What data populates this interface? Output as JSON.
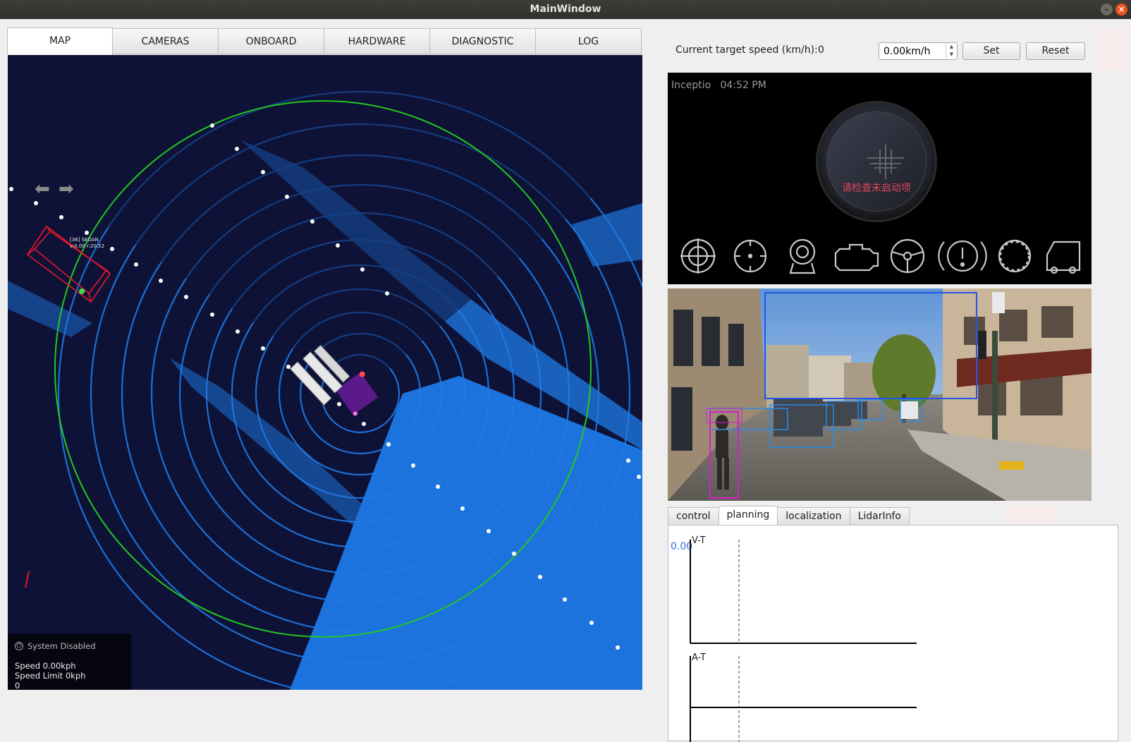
{
  "window": {
    "title": "MainWindow"
  },
  "tabs": [
    {
      "label": "MAP",
      "active": true
    },
    {
      "label": "CAMERAS",
      "active": false
    },
    {
      "label": "ONBOARD",
      "active": false
    },
    {
      "label": "HARDWARE",
      "active": false
    },
    {
      "label": "DIAGNOSTIC",
      "active": false
    },
    {
      "label": "LOG",
      "active": false
    }
  ],
  "map": {
    "status_title": "System Disabled",
    "speed": "Speed 0.00kph",
    "speed_limit": "Speed Limit 0kph",
    "extra": "0",
    "obstacle_label_1": "[36] SEDAN",
    "obstacle_label_2": "v:0.00 r:20.52",
    "colors": {
      "background": "#0e1237",
      "points": "#1f7ae6",
      "range_ring": "#21c821",
      "obstacle_box": "#e8172a",
      "trajectory": "#ffffff"
    }
  },
  "speed_control": {
    "label": "Current target speed (km/h):",
    "value": "0",
    "input_value": "0.00km/h",
    "set_label": "Set",
    "reset_label": "Reset"
  },
  "dashboard": {
    "brand": "Inceptio",
    "time": "04:52 PM",
    "dial_message": "请检查未启动项",
    "icons": [
      "radar-icon",
      "target-icon",
      "camera-sensor-icon",
      "engine-icon",
      "steering-wheel-icon",
      "brake-warning-icon",
      "tire-icon",
      "truck-icon"
    ]
  },
  "subtabs": [
    {
      "label": "control",
      "active": false
    },
    {
      "label": "planning",
      "active": true
    },
    {
      "label": "localization",
      "active": false
    },
    {
      "label": "LidarInfo",
      "active": false
    }
  ],
  "planning": {
    "value": "0.00",
    "vt_title": "V-T",
    "at_title": "A-T"
  }
}
